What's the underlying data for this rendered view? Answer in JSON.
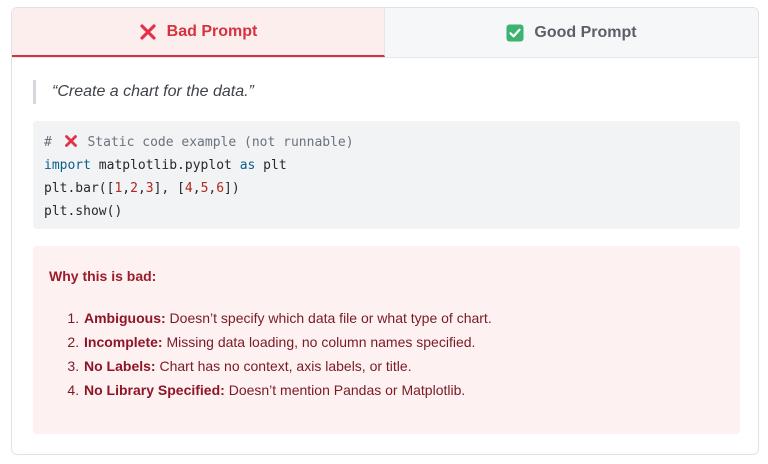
{
  "tabs": {
    "bad": {
      "label": "Bad Prompt",
      "icon": "red-x-icon",
      "active": true
    },
    "good": {
      "label": "Good Prompt",
      "icon": "green-check-icon",
      "active": false
    }
  },
  "prompt_quote": "“Create a chart for the data.”",
  "code": {
    "comment_prefix": "# ",
    "comment_text": " Static code example (not runnable)",
    "line2": {
      "kw_import": "import",
      "module": " matplotlib.pyplot ",
      "kw_as": "as",
      "alias": " plt"
    },
    "line3": {
      "pre": "plt.bar([",
      "n1": "1",
      "c1": ",",
      "n2": "2",
      "c2": ",",
      "n3": "3",
      "mid": "], [",
      "n4": "4",
      "c3": ",",
      "n5": "5",
      "c4": ",",
      "n6": "6",
      "post": "])"
    },
    "line4": "plt.show()"
  },
  "why": {
    "title": "Why this is bad:",
    "items": [
      {
        "label": "Ambiguous:",
        "text": " Doesn’t specify which data file or what type of chart."
      },
      {
        "label": "Incomplete:",
        "text": " Missing data loading, no column names specified."
      },
      {
        "label": "No Labels:",
        "text": " Chart has no context, axis labels, or title."
      },
      {
        "label": "No Library Specified:",
        "text": " Doesn’t mention Pandas or Matplotlib."
      }
    ]
  },
  "colors": {
    "bad_accent": "#d6323e",
    "good_check": "#3cb371",
    "bad_panel_bg": "#fdf1f1",
    "code_bg": "#f1f3f5"
  }
}
